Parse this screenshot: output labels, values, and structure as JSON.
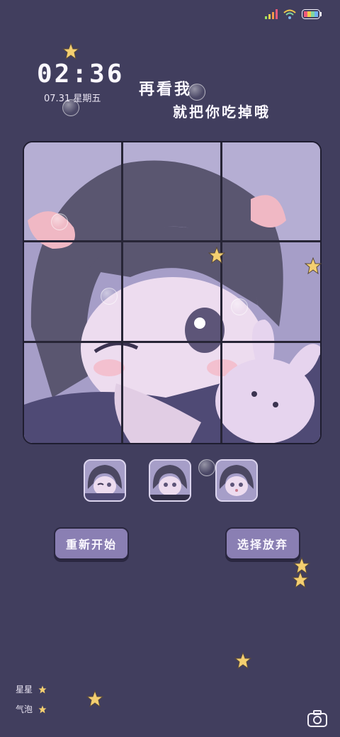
{
  "clock": {
    "time": "02:36",
    "date": "07.31 星期五"
  },
  "message": {
    "line1": "再看我",
    "line2": "就把你吃掉哦"
  },
  "buttons": {
    "restart": "重新开始",
    "give_up": "选择放弃"
  },
  "legend": {
    "stars": "星星",
    "bubbles": "气泡"
  },
  "colors": {
    "background": "#413e5e",
    "button": "#8a7fb3",
    "puzzle_bg": "#a69ec8",
    "star": "#f4cf70"
  },
  "icons": [
    "signal-icon",
    "wifi-icon",
    "battery-icon",
    "camera-icon",
    "star-icon",
    "bubble-icon"
  ]
}
